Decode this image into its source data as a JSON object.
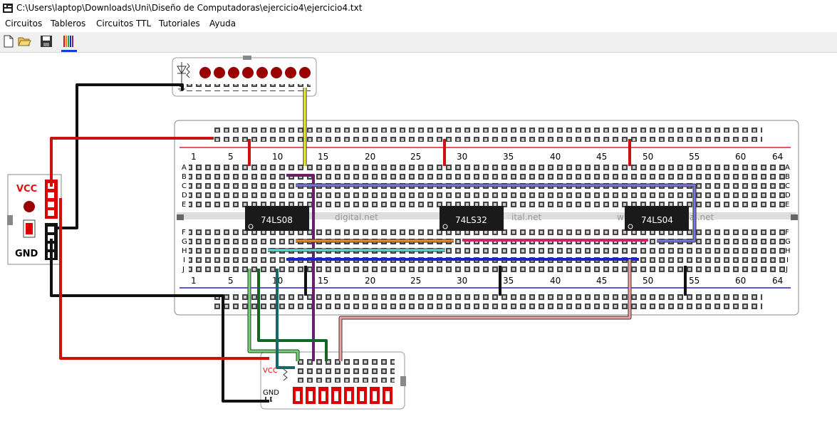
{
  "window": {
    "title": "C:\\Users\\laptop\\Downloads\\Uni\\Diseño de Computadoras\\ejercicio4\\ejercicio4.txt"
  },
  "menu": [
    "Circuitos",
    "Tableros",
    "Circuitos TTL",
    "Tutoriales",
    "Ayuda"
  ],
  "toolbar": {
    "buttons": [
      {
        "name": "new-file-icon"
      },
      {
        "name": "open-folder-icon"
      },
      {
        "name": "save-icon"
      },
      {
        "name": "wires-icon"
      }
    ]
  },
  "power_module": {
    "vcc_label": "VCC",
    "gnd_label": "GND"
  },
  "breadboard": {
    "column_numbers": [
      "1",
      "5",
      "10",
      "15",
      "20",
      "25",
      "30",
      "35",
      "40",
      "45",
      "50",
      "55",
      "60",
      "64"
    ],
    "rows_top": [
      "A",
      "B",
      "C",
      "D",
      "E"
    ],
    "rows_bottom": [
      "F",
      "G",
      "H",
      "I",
      "J"
    ],
    "watermark": [
      "digital.net",
      "ital.net",
      "w",
      "al.net"
    ]
  },
  "chips": [
    {
      "label": "74LS08"
    },
    {
      "label": "74LS32"
    },
    {
      "label": "74LS04"
    }
  ],
  "switch_module": {
    "vcc_label": "VCC",
    "gnd_label": "GND"
  },
  "colors": {
    "wire_red": "#cc1111",
    "wire_black": "#111111",
    "wire_yellow": "#f5f52a",
    "wire_purple": "#6a1e6e",
    "wire_blue_light": "#7777dd",
    "wire_orange": "#f08a30",
    "wire_pink": "#cc2266",
    "wire_cyan": "#66dddd",
    "wire_navy": "#1a22cc",
    "wire_green_light": "#6ed86e",
    "wire_green_dark": "#116622",
    "wire_teal": "#1a6666",
    "wire_salmon": "#f0a0a0",
    "led_red": "#990000",
    "switch_red": "#dd0000"
  }
}
